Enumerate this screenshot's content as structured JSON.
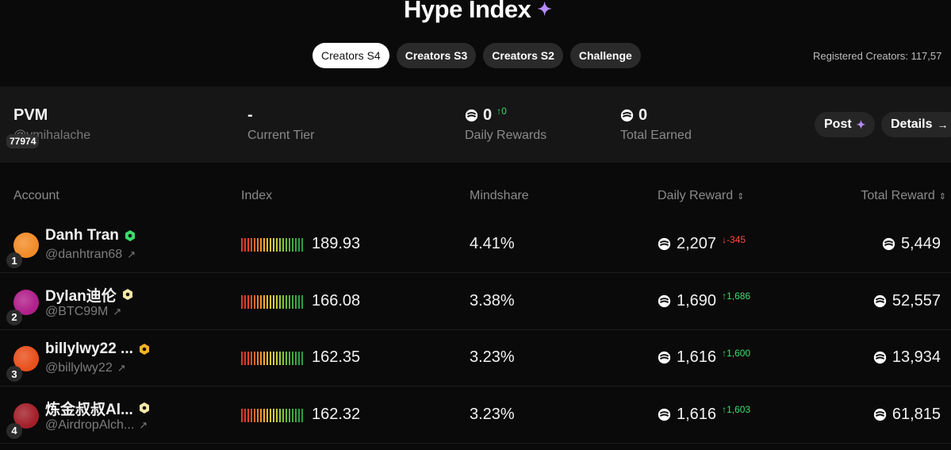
{
  "header": {
    "title": "Hype Index",
    "tabs": [
      "Creators S4",
      "Creators S3",
      "Creators S2",
      "Challenge"
    ],
    "active_tab": 0,
    "registered_label": "Registered Creators: 117,57"
  },
  "my_stats": {
    "name": "PVM",
    "handle": "@vmihalache",
    "rank": "77974",
    "tier_value": "-",
    "tier_label": "Current Tier",
    "daily_value": "0",
    "daily_delta": "0",
    "daily_label": "Daily Rewards",
    "total_value": "0",
    "total_label": "Total Earned",
    "post_label": "Post",
    "details_label": "Details"
  },
  "table": {
    "headers": {
      "account": "Account",
      "index": "Index",
      "mindshare": "Mindshare",
      "daily_reward": "Daily Reward",
      "total_reward": "Total Reward"
    },
    "rows": [
      {
        "rank": "1",
        "name": "Danh Tran",
        "handle": "@danhtran68",
        "badge_color": "#3ddc6b",
        "avatar_color": "#f28c28",
        "index": "189.93",
        "mindshare": "4.41%",
        "daily": "2,207",
        "delta": "-345",
        "delta_dir": "down",
        "total": "5,449"
      },
      {
        "rank": "2",
        "name": "Dylan迪伦",
        "handle": "@BTC99M",
        "badge_color": "#f5e7a8",
        "avatar_color": "#b0208a",
        "index": "166.08",
        "mindshare": "3.38%",
        "daily": "1,690",
        "delta": "1,686",
        "delta_dir": "up",
        "total": "52,557"
      },
      {
        "rank": "3",
        "name": "billylwy22 ...",
        "handle": "@billylwy22",
        "badge_color": "#f0b429",
        "avatar_color": "#e8501c",
        "index": "162.35",
        "mindshare": "3.23%",
        "daily": "1,616",
        "delta": "1,600",
        "delta_dir": "up",
        "total": "13,934"
      },
      {
        "rank": "4",
        "name": "炼金叔叔Al...",
        "handle": "@AirdropAlch...",
        "badge_color": "#f5e7a8",
        "avatar_color": "#a3202a",
        "index": "162.32",
        "mindshare": "3.23%",
        "daily": "1,616",
        "delta": "1,603",
        "delta_dir": "up",
        "total": "61,815"
      }
    ]
  },
  "colors": {
    "background": "#0a0a0a",
    "panel": "#161616",
    "accent_up": "#3ddc6b",
    "accent_down": "#ff4a3d",
    "sparkle": "#b48cff"
  },
  "icons": [
    "sparkle-icon",
    "coin-icon",
    "external-link-icon",
    "verified-badge-icon",
    "sort-icon",
    "arrow-right-icon"
  ]
}
